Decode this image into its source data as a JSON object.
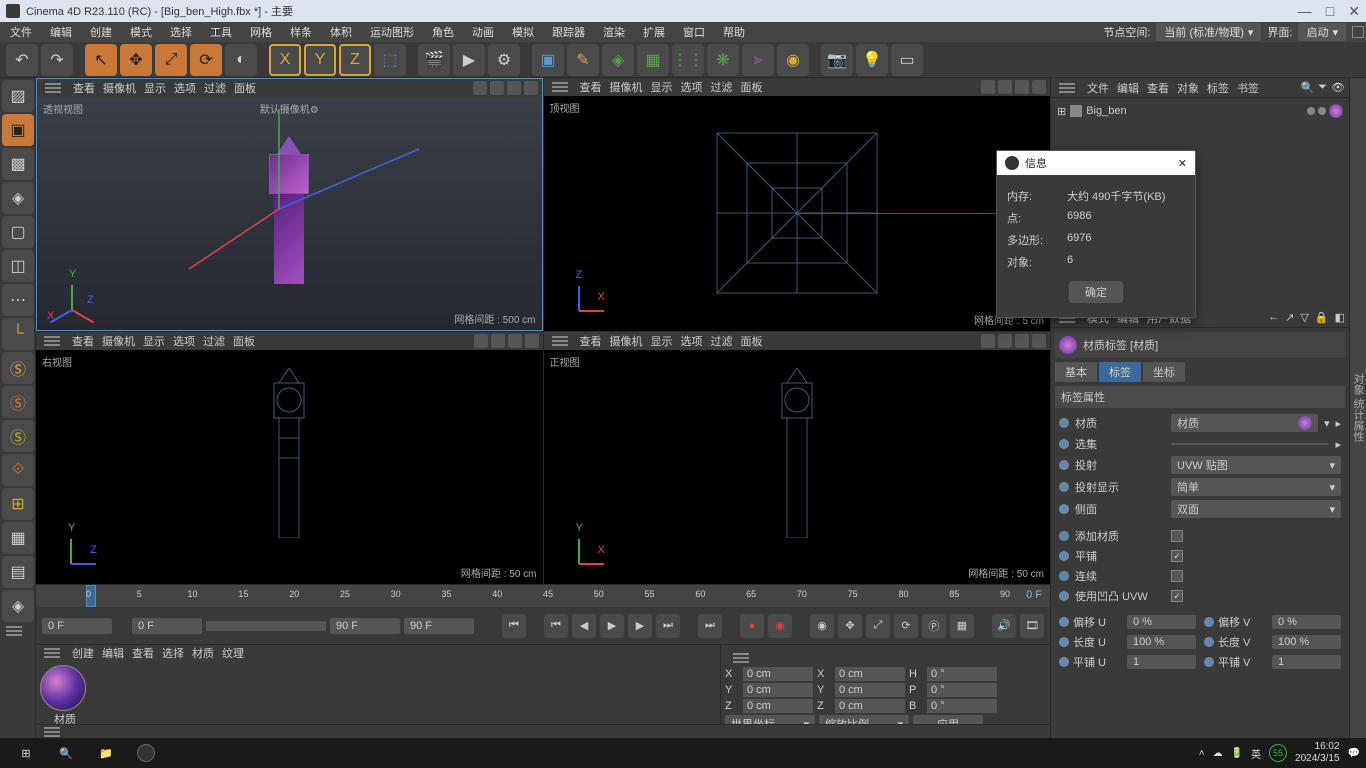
{
  "titlebar": {
    "title": "Cinema 4D R23.110 (RC) - [Big_ben_High.fbx *] - 主要"
  },
  "window_btns": {
    "min": "—",
    "max": "□",
    "close": "✕"
  },
  "menubar": {
    "items": [
      "文件",
      "编辑",
      "创建",
      "模式",
      "选择",
      "工具",
      "网格",
      "样条",
      "体积",
      "运动图形",
      "角色",
      "动画",
      "模拟",
      "跟踪器",
      "渲染",
      "扩展",
      "窗口",
      "帮助"
    ],
    "node_space_label": "节点空间:",
    "node_space_value": "当前 (标准/物理)",
    "layout_label": "界面:",
    "layout_value": "启动"
  },
  "viewport_menus": [
    "查看",
    "摄像机",
    "显示",
    "选项",
    "过滤",
    "面板"
  ],
  "viewports": {
    "persp": {
      "label": "透视视图",
      "cam": "默认摄像机",
      "grid": "网格间距 : 500 cm"
    },
    "top": {
      "label": "顶视图",
      "grid": "网格间距 : 5 cm"
    },
    "right": {
      "label": "右视图",
      "grid": "网格间距 : 50 cm"
    },
    "front": {
      "label": "正视图",
      "grid": "网格间距 : 50 cm"
    }
  },
  "object_panel": {
    "menus": [
      "文件",
      "编辑",
      "查看",
      "对象",
      "标签",
      "书签"
    ],
    "item_name": "Big_ben"
  },
  "info_dialog": {
    "title": "信息",
    "rows": {
      "memory_label": "内存:",
      "memory_value": "大约 490千字节(KB)",
      "points_label": "点:",
      "points_value": "6986",
      "polys_label": "多边形:",
      "polys_value": "6976",
      "objects_label": "对象:",
      "objects_value": "6"
    },
    "ok": "确定"
  },
  "attr_panel": {
    "menus": [
      "模式",
      "编辑",
      "用户数据"
    ],
    "header": "材质标签 [材质]",
    "tabs": [
      "基本",
      "标签",
      "坐标"
    ],
    "section": "标签属性",
    "material_label": "材质",
    "material_value": "材质",
    "selection_label": "选集",
    "projection_label": "投射",
    "projection_value": "UVW 贴图",
    "proj_display_label": "投射显示",
    "proj_display_value": "简单",
    "side_label": "侧面",
    "side_value": "双面",
    "add_mat_label": "添加材质",
    "tile_label": "平铺",
    "continuous_label": "连续",
    "use_bump_label": "使用凹凸 UVW",
    "offset_u_label": "偏移 U",
    "offset_u_value": "0 %",
    "offset_v_label": "偏移 V",
    "offset_v_value": "0 %",
    "length_u_label": "长度 U",
    "length_u_value": "100 %",
    "length_v_label": "长度 V",
    "length_v_value": "100 %",
    "tile_u_label": "平铺 U",
    "tile_u_value": "1",
    "tile_v_label": "平铺 V",
    "tile_v_value": "1"
  },
  "timeline": {
    "start_field": "0 F",
    "start2": "0 F",
    "end2": "90 F",
    "end_field": "90 F",
    "current": "0  F",
    "ticks": [
      "0",
      "5",
      "10",
      "15",
      "20",
      "25",
      "30",
      "35",
      "40",
      "45",
      "50",
      "55",
      "60",
      "65",
      "70",
      "75",
      "80",
      "85",
      "90"
    ]
  },
  "material_panel": {
    "menus": [
      "创建",
      "编辑",
      "查看",
      "选择",
      "材质",
      "纹理"
    ],
    "thumb_label": "材质"
  },
  "coord_panel": {
    "x": "0 cm",
    "y": "0 cm",
    "z": "0 cm",
    "x2": "0 cm",
    "y2": "0 cm",
    "z2": "0 cm",
    "h": "0 °",
    "p": "0 °",
    "b": "0 °",
    "world": "世界坐标",
    "scale": "缩放比例",
    "apply": "应用"
  },
  "taskbar": {
    "ime": "英",
    "battery": "55",
    "time": "16:02",
    "date": "2024/3/15"
  },
  "axis": {
    "x": "X",
    "y": "Y",
    "z": "Z"
  }
}
